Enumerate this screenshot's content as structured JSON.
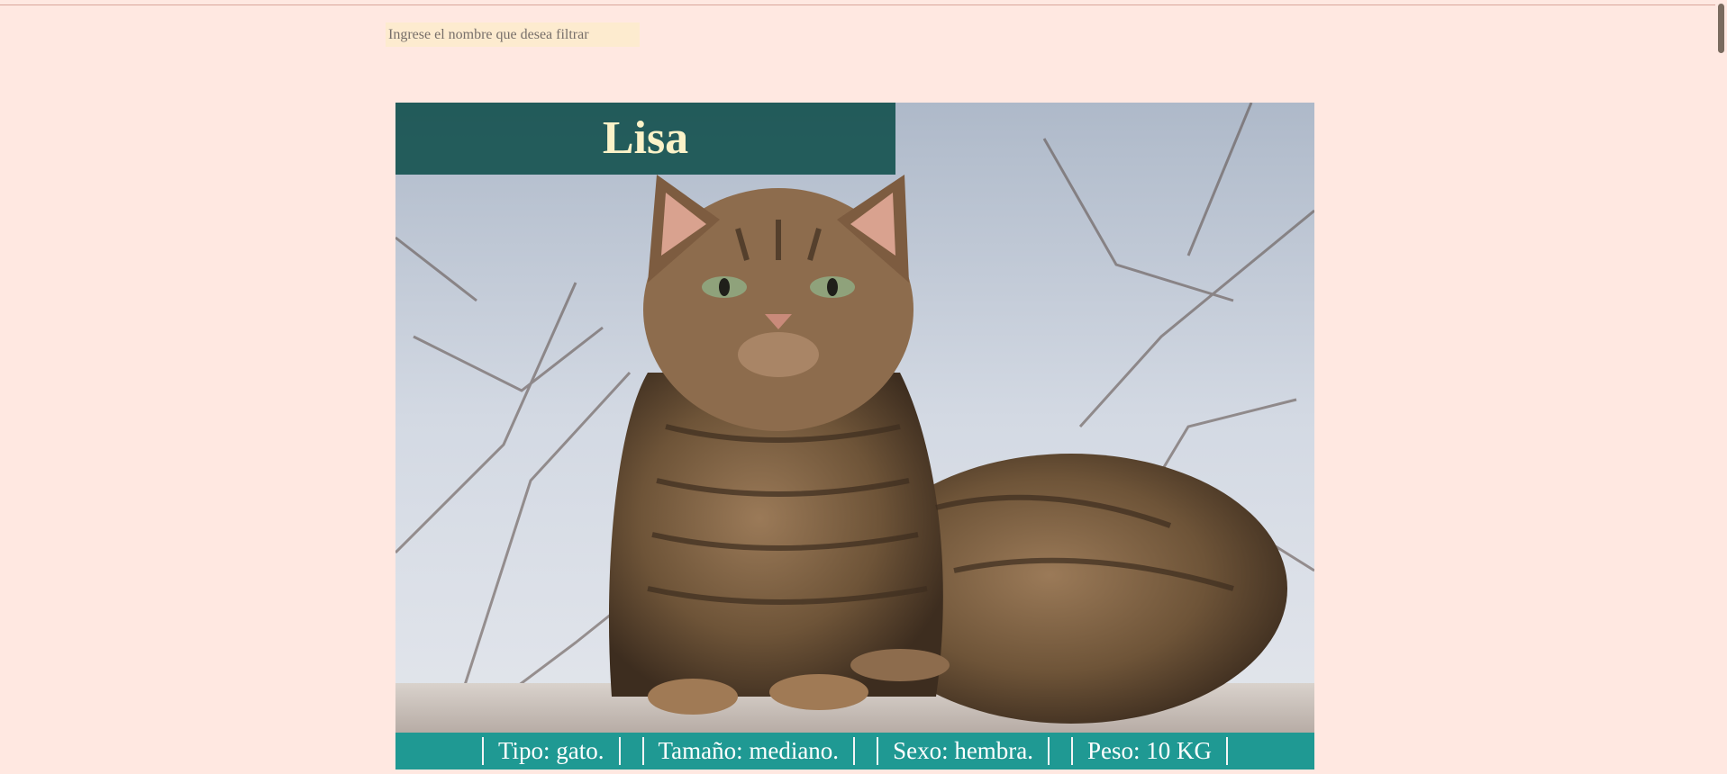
{
  "filter": {
    "placeholder": "Ingrese el nombre que desea filtrar"
  },
  "pet": {
    "name": "Lisa",
    "photo_icon": "tabby-cat-photo",
    "info": [
      "Tipo: gato.",
      "Tamaño: mediano.",
      "Sexo: hembra.",
      "Peso: 10 KG"
    ]
  },
  "colors": {
    "page_background": "#ffe8e1",
    "input_background": "#fdebcf",
    "name_banner": "#185452",
    "name_text": "#fbf2c8",
    "info_bar": "#1f9993"
  }
}
